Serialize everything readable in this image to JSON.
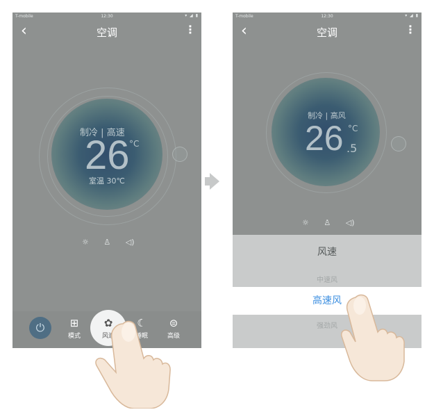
{
  "status_bar": {
    "carrier": "T-mobile",
    "time": "12:30",
    "icons": "▾ ◢ ▮"
  },
  "screen_a": {
    "title": "空调",
    "mode": "制冷",
    "fan": "高速",
    "temperature": "26",
    "unit": "°C",
    "room_temp": "室温 30℃",
    "nav": {
      "mode": "模式",
      "wind": "风速",
      "sleep": "睡眠",
      "advanced": "高级"
    }
  },
  "screen_b": {
    "title": "空调",
    "mode": "制冷",
    "fan": "高风",
    "temperature": "26",
    "decimal": ".5",
    "unit": "°C",
    "picker": {
      "title": "风速",
      "options": [
        "中速风",
        "高速风",
        "强劲风"
      ],
      "selected": "高速风"
    }
  },
  "icons": {
    "back": "chevron-left",
    "more": "vertical-dots",
    "light": "bulb",
    "child_lock": "lock",
    "sound": "speaker",
    "power": "power",
    "mode": "grid",
    "wind": "fan",
    "sleep": "moon",
    "advanced": "menu-circle"
  },
  "colors": {
    "overlay": "#8e9190",
    "accent": "#3d8fe0",
    "power": "#4f6e84"
  }
}
